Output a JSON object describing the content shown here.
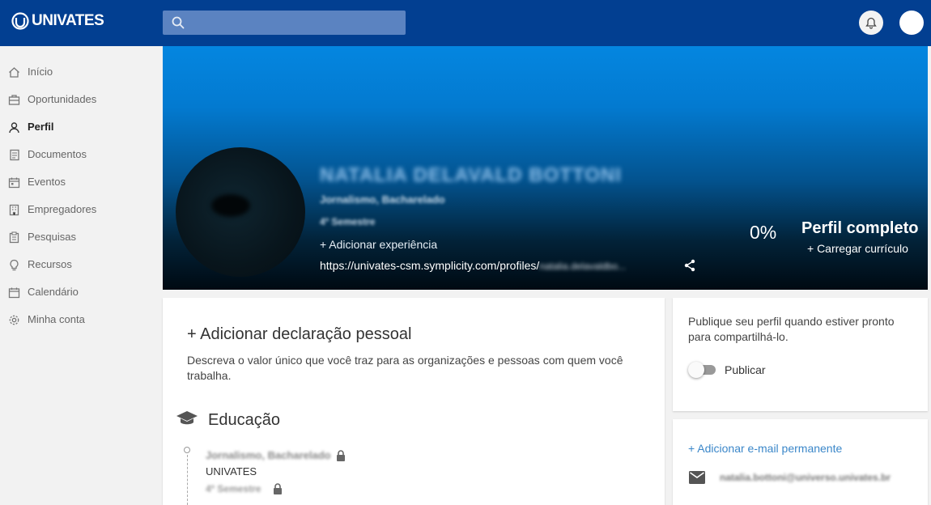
{
  "header": {
    "brand": "UNIVATES",
    "search_placeholder": ""
  },
  "sidebar": {
    "items": [
      {
        "label": "Início",
        "icon": "home-icon"
      },
      {
        "label": "Oportunidades",
        "icon": "briefcase-icon"
      },
      {
        "label": "Perfil",
        "icon": "person-icon",
        "active": true
      },
      {
        "label": "Documentos",
        "icon": "document-icon"
      },
      {
        "label": "Eventos",
        "icon": "calendar-event-icon"
      },
      {
        "label": "Empregadores",
        "icon": "building-icon"
      },
      {
        "label": "Pesquisas",
        "icon": "clipboard-icon"
      },
      {
        "label": "Recursos",
        "icon": "lightbulb-icon"
      },
      {
        "label": "Calendário",
        "icon": "calendar-icon"
      },
      {
        "label": "Minha conta",
        "icon": "gear-icon"
      }
    ]
  },
  "hero": {
    "name": "NATALIA DELAVALD BOTTONI",
    "degree": "Jornalismo, Bacharelado",
    "semester": "4º Semestre",
    "add_experience": "+ Adicionar experiência",
    "url_prefix": "https://univates-csm.symplicity.com/profiles/",
    "url_suffix": "natalia.delavaldbo...",
    "completion": "0%",
    "completion_label": "Perfil completo",
    "upload_resume": "+ Carregar currículo"
  },
  "statement": {
    "title": "+ Adicionar declaração pessoal",
    "description": "Descreva o valor único que você traz para as organizações e pessoas com quem você trabalha."
  },
  "education": {
    "title": "Educação",
    "degree": "Jornalismo, Bacharelado",
    "school": "UNIVATES",
    "semester": "4º Semestre"
  },
  "publish": {
    "text": "Publique seu perfil quando estiver pronto para compartilhá-lo.",
    "toggle_label": "Publicar"
  },
  "contact": {
    "add_email": "+ Adicionar e-mail permanente",
    "email": "natalia.bottoni@universo.univates.br"
  },
  "colors": {
    "topbar": "#023f91",
    "link": "#3b87c9"
  }
}
